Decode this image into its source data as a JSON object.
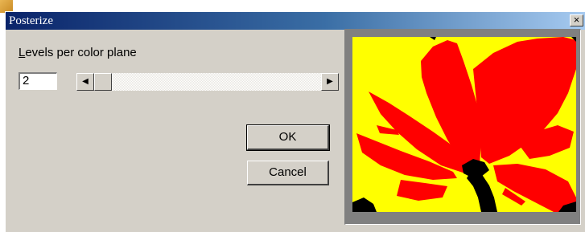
{
  "window": {
    "title": "Posterize",
    "close_glyph": "×"
  },
  "levels": {
    "label_mnemonic": "L",
    "label_rest": "evels per color plane",
    "value": "2",
    "scroll_left_glyph": "◀",
    "scroll_right_glyph": "▶",
    "slider_fraction": 0
  },
  "buttons": {
    "ok_label": "OK",
    "cancel_label": "Cancel"
  },
  "preview": {
    "colors": [
      "#ffff00",
      "#ff0000",
      "#000000"
    ]
  },
  "icons": [
    "close-icon",
    "scroll-left-arrow-icon",
    "scroll-right-arrow-icon"
  ]
}
